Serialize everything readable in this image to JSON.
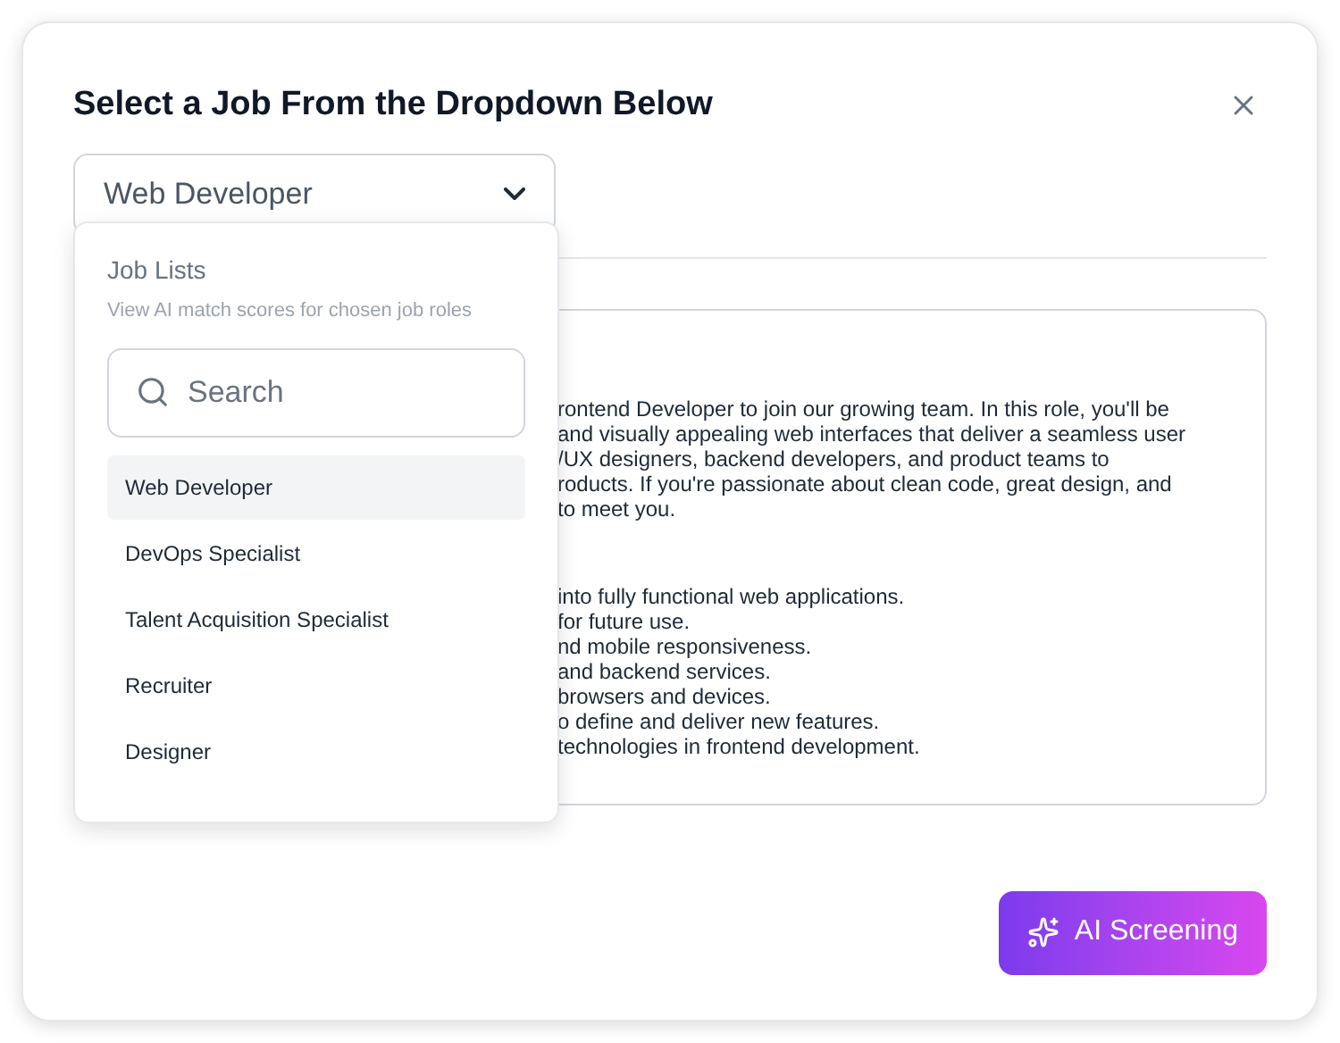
{
  "title": "Select a Job From the Dropdown Below",
  "dropdown": {
    "value": "Web Developer",
    "expanded": true
  },
  "menu": {
    "heading": "Job Lists",
    "subheading": "View AI match scores for chosen job roles",
    "search": {
      "placeholder": "Search"
    },
    "items": [
      {
        "label": "Web Developer",
        "selected": true
      },
      {
        "label": "DevOps Specialist",
        "selected": false
      },
      {
        "label": "Talent Acquisition Specialist",
        "selected": false
      },
      {
        "label": "Recruiter",
        "selected": false
      },
      {
        "label": "Designer",
        "selected": false
      }
    ]
  },
  "description": {
    "paragraph_lines": [
      "rontend Developer to join our growing team. In this role, you'll be",
      "and visually appealing web interfaces that deliver a seamless user",
      "/UX designers, backend developers, and product teams to",
      "roducts. If you're passionate about clean code, great design, and",
      "to meet you."
    ],
    "list_lines": [
      "into fully functional web applications.",
      "for future use.",
      "nd mobile responsiveness.",
      "and backend services.",
      "browsers and devices.",
      "o define and deliver new features.",
      "technologies in frontend development."
    ]
  },
  "action_button": "AI Screening"
}
